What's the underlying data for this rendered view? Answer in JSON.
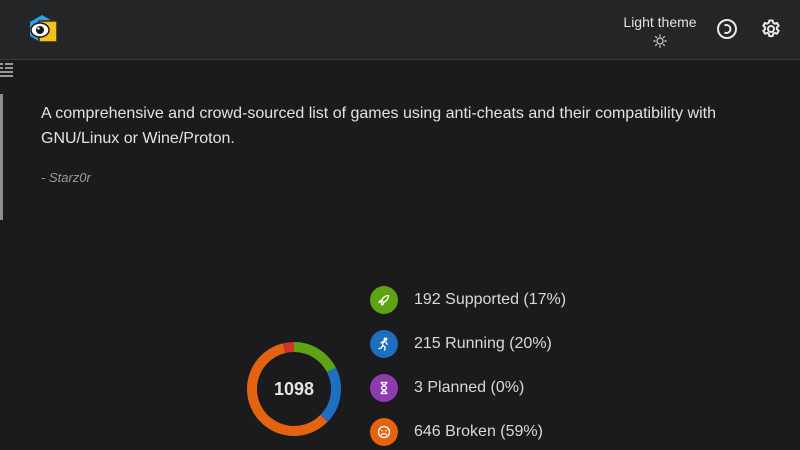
{
  "header": {
    "logo_icon": "eye-shield-logo",
    "theme_toggle_label": "Light theme",
    "theme_icon": "sun-icon",
    "status_icon": "circle-arrow-icon",
    "settings_icon": "gear-icon"
  },
  "sidebar": {
    "toggle_icon": "list-icon"
  },
  "quote": {
    "text": "A comprehensive and crowd-sourced list of games using anti-cheats and their compatibility with GNU/Linux or Wine/Proton.",
    "author": "- Starz0r"
  },
  "stats": {
    "total": "1098",
    "items": [
      {
        "label": "192 Supported (17%)",
        "icon": "rocket-icon",
        "color": "#5da313",
        "count": 192
      },
      {
        "label": "215 Running (20%)",
        "icon": "running-person-icon",
        "color": "#1e6fc2",
        "count": 215
      },
      {
        "label": "3 Planned (0%)",
        "icon": "hourglass-icon",
        "color": "#8e3bb0",
        "count": 3
      },
      {
        "label": "646 Broken (59%)",
        "icon": "sad-face-icon",
        "color": "#e46310",
        "count": 646
      }
    ],
    "remainder": {
      "count": 42,
      "color": "#d0342c"
    }
  }
}
